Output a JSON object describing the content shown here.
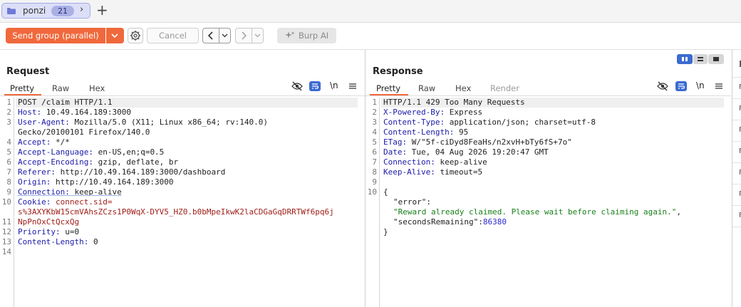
{
  "tab": {
    "name": "ponzi",
    "count": "21"
  },
  "toolbar": {
    "send_label": "Send group (parallel)",
    "cancel_label": "Cancel",
    "burp_ai_label": "Burp AI"
  },
  "request": {
    "title": "Request",
    "tabs": [
      "Pretty",
      "Raw",
      "Hex"
    ],
    "active_tab": "Pretty",
    "line_numbers": [
      "1",
      "2",
      "3",
      "",
      "4",
      "5",
      "6",
      "7",
      "8",
      "9",
      "10",
      "",
      "11",
      "12",
      "13",
      "14"
    ],
    "lines": [
      {
        "name": "POST /claim HTTP/1.1",
        "value": ""
      },
      {
        "name": "Host:",
        "value": " 10.49.164.189:3000"
      },
      {
        "name": "User-Agent:",
        "value": " Mozilla/5.0 (X11; Linux x86_64; rv:140.0)"
      },
      {
        "name": "",
        "value": "Gecko/20100101 Firefox/140.0"
      },
      {
        "name": "Accept:",
        "value": " */*"
      },
      {
        "name": "Accept-Language:",
        "value": " en-US,en;q=0.5"
      },
      {
        "name": "Accept-Encoding:",
        "value": " gzip, deflate, br"
      },
      {
        "name": "Referer:",
        "value": " http://10.49.164.189:3000/dashboard"
      },
      {
        "name": "Origin:",
        "value": " http://10.49.164.189:3000"
      },
      {
        "name": "Connection:",
        "value": " keep-alive"
      },
      {
        "name": "Cookie:",
        "value": " connect.sid="
      },
      {
        "name": "",
        "value": "s%3AXYKbW15cmVAhsZCzs1P0WqX-DYV5_HZ0.b0bMpeIkwK2laCDGaGqDRRTWf6pq6j"
      },
      {
        "name": "",
        "value": "NpPnOxCtQcxQg"
      },
      {
        "name": "Priority:",
        "value": " u=0"
      },
      {
        "name": "Content-Length:",
        "value": " 0"
      },
      {
        "name": "",
        "value": ""
      }
    ]
  },
  "response": {
    "title": "Response",
    "tabs": [
      "Pretty",
      "Raw",
      "Hex",
      "Render"
    ],
    "active_tab": "Pretty",
    "line_numbers": [
      "1",
      "2",
      "3",
      "4",
      "5",
      "6",
      "7",
      "8",
      "9",
      "10",
      "",
      "",
      "",
      ""
    ],
    "status_line": "HTTP/1.1 429 Too Many Requests",
    "headers": [
      {
        "name": "X-Powered-By:",
        "value": " Express"
      },
      {
        "name": "Content-Type:",
        "value": " application/json; charset=utf-8"
      },
      {
        "name": "Content-Length:",
        "value": " 95"
      },
      {
        "name": "ETag:",
        "value": " W/\"5f-ciDyd8FeaHs/n2xvH+bTy6fS+7o\""
      },
      {
        "name": "Date:",
        "value": " Tue, 04 Aug 2026 19:20:47 GMT"
      },
      {
        "name": "Connection:",
        "value": " keep-alive"
      },
      {
        "name": "Keep-Alive:",
        "value": " timeout=5"
      }
    ],
    "json": {
      "open": "{",
      "error_key": "\"error\"",
      "error_colon": ":",
      "error_value": "\"Reward already claimed. Please wait before claiming again.\"",
      "seconds_key": "\"secondsRemaining\"",
      "seconds_colon": ":",
      "seconds_value": "86380",
      "close": "}",
      "comma": ","
    }
  },
  "icons": {
    "hide": "eye-slash-icon",
    "wrap": "wrap-lines-icon",
    "newline": "\\n",
    "menu": "menu-icon"
  },
  "side_panel": {
    "header": "I",
    "rows": [
      "F",
      "F",
      "F",
      "F",
      "F",
      "F",
      "F"
    ]
  },
  "colors": {
    "accent": "#f0693c",
    "active_icon": "#3b6bd1",
    "header_name": "#1a1aa8",
    "cookie": "#a0201a",
    "json_string": "#19801a",
    "json_number": "#2a2ad0"
  }
}
